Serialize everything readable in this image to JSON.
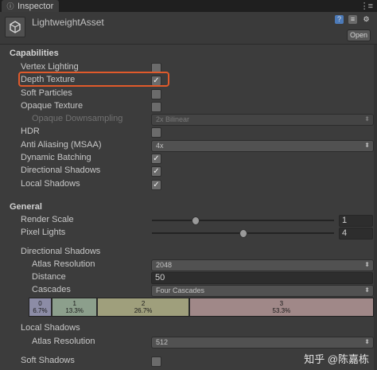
{
  "tab": {
    "icon": "info-icon",
    "label": "Inspector"
  },
  "header": {
    "title": "LightweightAsset",
    "open_label": "Open"
  },
  "capabilities": {
    "section": "Capabilities",
    "vertex_lighting": "Vertex Lighting",
    "depth_texture": "Depth Texture",
    "soft_particles": "Soft Particles",
    "opaque_texture": "Opaque Texture",
    "opaque_downsampling": "Opaque Downsampling",
    "opaque_downsampling_value": "2x Bilinear",
    "hdr": "HDR",
    "anti_aliasing": "Anti Aliasing (MSAA)",
    "anti_aliasing_value": "4x",
    "dynamic_batching": "Dynamic Batching",
    "directional_shadows": "Directional Shadows",
    "local_shadows": "Local Shadows",
    "checked": {
      "vertex_lighting": false,
      "depth_texture": true,
      "soft_particles": false,
      "opaque_texture": false,
      "hdr": false,
      "dynamic_batching": true,
      "directional_shadows": true,
      "local_shadows": true
    }
  },
  "general": {
    "section": "General",
    "render_scale": "Render Scale",
    "render_scale_value": "1",
    "render_scale_fraction": 0.24,
    "pixel_lights": "Pixel Lights",
    "pixel_lights_value": "4",
    "pixel_lights_fraction": 0.5,
    "directional_shadows": "Directional Shadows",
    "atlas_resolution": "Atlas Resolution",
    "atlas_resolution_value": "2048",
    "distance": "Distance",
    "distance_value": "50",
    "cascades": "Cascades",
    "cascades_value": "Four Cascades",
    "cascade_segments": [
      {
        "index": "0",
        "percent": "6.7%",
        "fraction": 0.067,
        "color": "#8c8ca6"
      },
      {
        "index": "1",
        "percent": "13.3%",
        "fraction": 0.133,
        "color": "#8c9f8c"
      },
      {
        "index": "2",
        "percent": "26.7%",
        "fraction": 0.267,
        "color": "#9f9f7c"
      },
      {
        "index": "3",
        "percent": "53.3%",
        "fraction": 0.533,
        "color": "#a08888"
      }
    ],
    "local_shadows": "Local Shadows",
    "local_atlas_resolution": "Atlas Resolution",
    "local_atlas_resolution_value": "512",
    "soft_shadows": "Soft Shadows",
    "soft_shadows_checked": false
  },
  "watermark": "知乎 @陈嘉栋",
  "colors": {
    "highlight": "#e05a2b",
    "background": "#3c3c3c"
  }
}
